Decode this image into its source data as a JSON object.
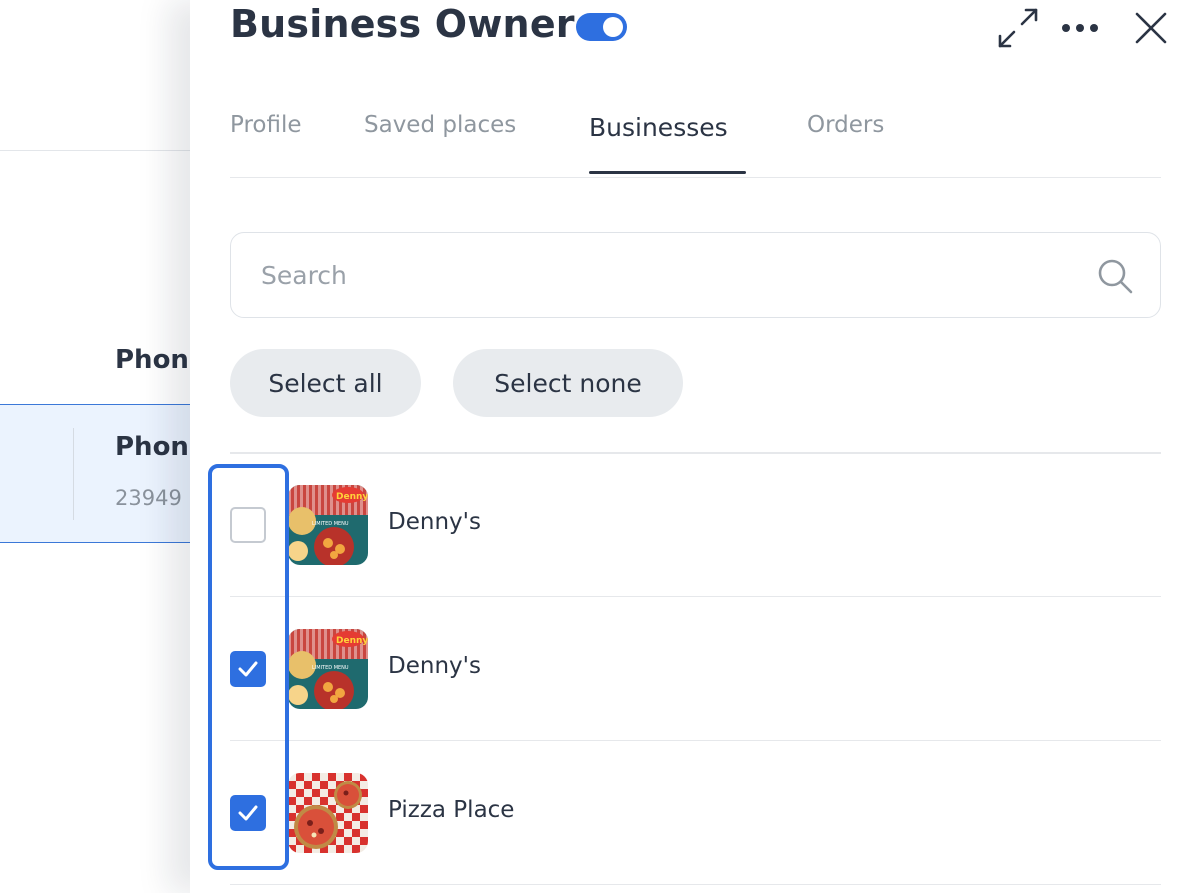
{
  "background": {
    "column_header": "Phone",
    "row_title": "Phone",
    "row_subtitle": "23949"
  },
  "drawer": {
    "title": "Business Owner",
    "owner_toggle_on": true,
    "tabs": [
      {
        "label": "Profile",
        "active": false
      },
      {
        "label": "Saved places",
        "active": false
      },
      {
        "label": "Businesses",
        "active": true
      },
      {
        "label": "Orders",
        "active": false
      }
    ],
    "search": {
      "placeholder": "Search",
      "value": ""
    },
    "select_all_label": "Select all",
    "select_none_label": "Select none",
    "businesses": [
      {
        "name": "Denny's",
        "checked": false,
        "thumbnail": "dennys"
      },
      {
        "name": "Denny's",
        "checked": true,
        "thumbnail": "dennys"
      },
      {
        "name": "Pizza Place",
        "checked": true,
        "thumbnail": "pizza"
      }
    ]
  },
  "icons": {
    "expand": "expand-icon",
    "more": "more-horizontal-icon",
    "close": "close-icon",
    "search": "search-icon",
    "check": "check-icon"
  },
  "colors": {
    "accent": "#2e6fe0",
    "text_primary": "#2b3444",
    "text_muted": "#8f979f",
    "selected_row_bg": "#ebf3fe",
    "pill_bg": "#e8ebee"
  }
}
